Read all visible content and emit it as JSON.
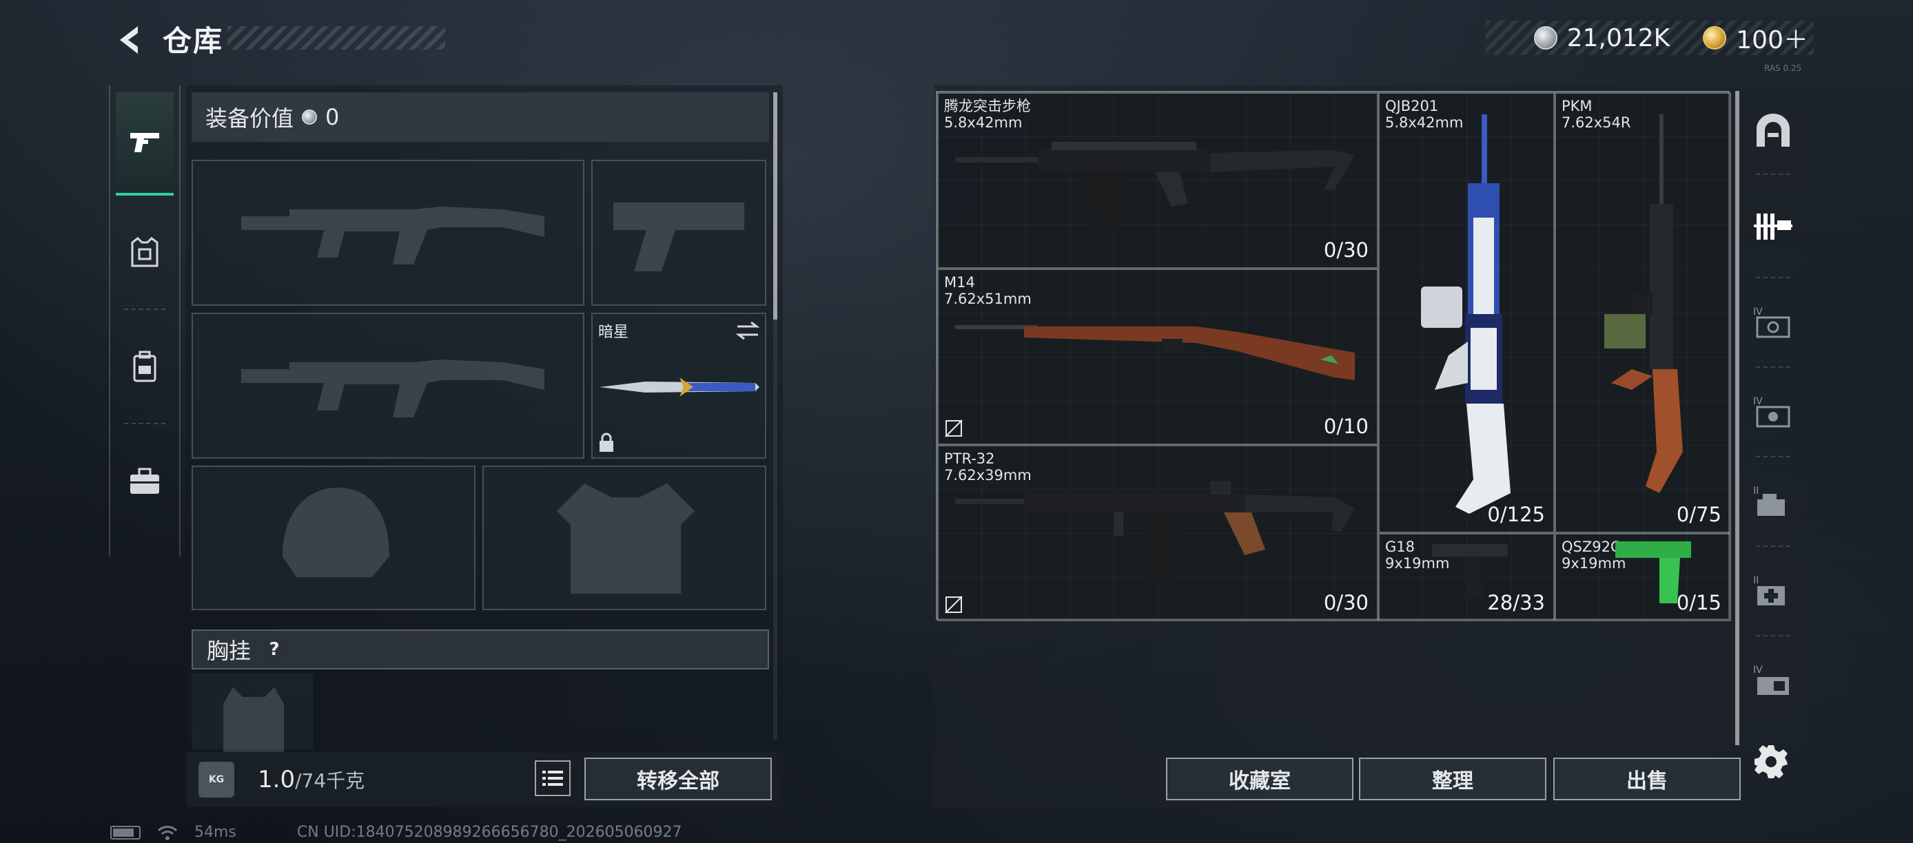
{
  "header": {
    "title": "仓库",
    "silver_amount": "21,012K",
    "gold_amount": "100＋",
    "version": "RAS 0.25"
  },
  "equipment": {
    "value_label": "装备价值",
    "value_amount": "0",
    "knife_name": "暗星",
    "chest_rig_label": "胸挂",
    "chest_rig_help": "?",
    "weight_current": "1.0",
    "weight_max": "/74千克",
    "weight_icon_text": "KG",
    "transfer_all_label": "转移全部"
  },
  "stash": {
    "items": [
      {
        "name": "腾龙突击步枪",
        "caliber": "5.8x42mm",
        "ammo": "0/30"
      },
      {
        "name": "M14",
        "caliber": "7.62x51mm",
        "ammo": "0/10"
      },
      {
        "name": "PTR-32",
        "caliber": "7.62x39mm",
        "ammo": "0/30"
      },
      {
        "name": "QJB201",
        "caliber": "5.8x42mm",
        "ammo": "0/125"
      },
      {
        "name": "PKM",
        "caliber": "7.62x54R",
        "ammo": "0/75"
      },
      {
        "name": "G18",
        "caliber": "9x19mm",
        "ammo": "28/33"
      },
      {
        "name": "QSZ92G",
        "caliber": "9x19mm",
        "ammo": "0/15"
      }
    ],
    "buttons": {
      "collection": "收藏室",
      "organize": "整理",
      "sell": "出售"
    }
  },
  "category_rail": {
    "tier_label": "IV"
  },
  "footer": {
    "ping": "54ms",
    "uid": "CN UID:184075208989266656780_202605060927"
  },
  "colors": {
    "accent": "#2fd2a0",
    "gold_coin": "#d6a436",
    "silver_coin": "#9ea6ad"
  }
}
